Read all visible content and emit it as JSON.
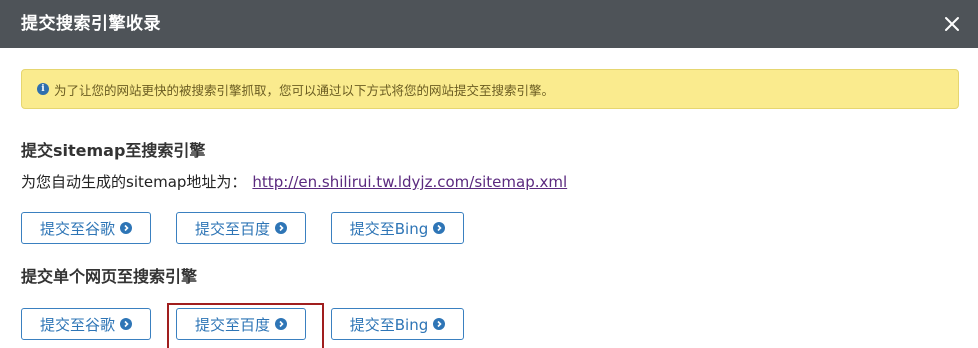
{
  "dialog": {
    "title": "提交搜索引擎收录",
    "close_icon": "close-icon"
  },
  "alert": {
    "icon": "info-icon",
    "icon_glyph": "i",
    "text": "为了让您的网站更快的被搜索引擎抓取，您可以通过以下方式将您的网站提交至搜索引擎。",
    "bg_color": "#faeb8e"
  },
  "sitemap_section": {
    "title": "提交sitemap至搜索引擎",
    "label": "为您自动生成的sitemap地址为：",
    "url": "http://en.shilirui.tw.ldyjz.com/sitemap.xml",
    "buttons": [
      {
        "label": "提交至谷歌",
        "icon": "chevron-circle-right-icon"
      },
      {
        "label": "提交至百度",
        "icon": "chevron-circle-right-icon"
      },
      {
        "label": "提交至Bing",
        "icon": "chevron-circle-right-icon"
      }
    ]
  },
  "single_page_section": {
    "title": "提交单个网页至搜索引擎",
    "buttons": [
      {
        "label": "提交至谷歌",
        "icon": "chevron-circle-right-icon"
      },
      {
        "label": "提交至百度",
        "icon": "chevron-circle-right-icon"
      },
      {
        "label": "提交至Bing",
        "icon": "chevron-circle-right-icon"
      }
    ]
  },
  "colors": {
    "header_bg": "#4e5358",
    "button_border": "#3a80c0",
    "button_text": "#2e75b6",
    "link": "#5b2a7f",
    "highlight": "#a01e1e"
  }
}
